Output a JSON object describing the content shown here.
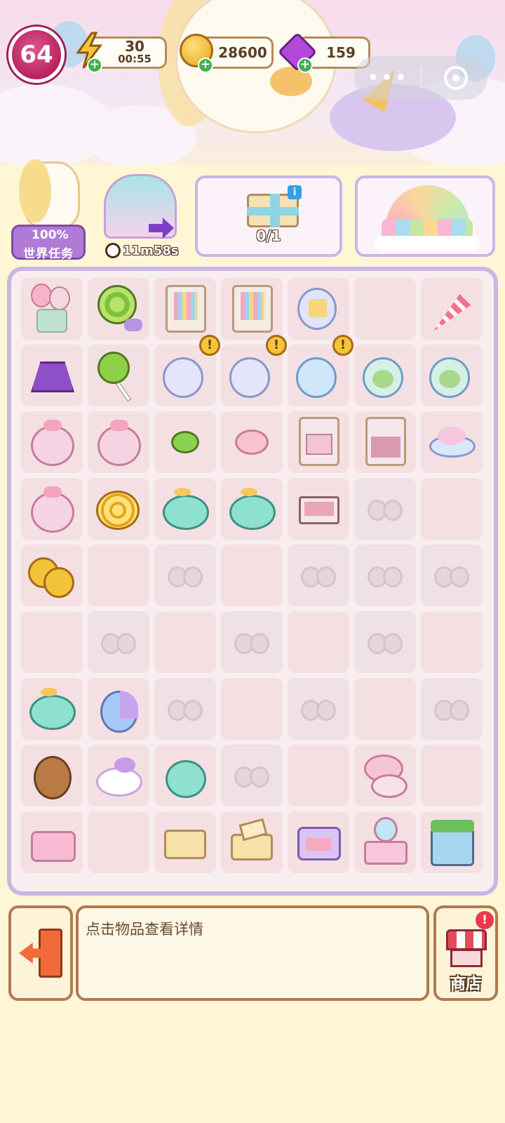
{
  "status": {
    "level": "64",
    "energy": "30",
    "energy_timer": "00:55",
    "coins": "28600",
    "gems": "159"
  },
  "features": {
    "world_task_percent": "100%",
    "world_task_label": "世界任务",
    "event_timer": "11m58s",
    "gift_progress": "0/1"
  },
  "board": {
    "cells": [
      "balloon-gift",
      "lollipop-swirl",
      "cabinet-open",
      "cabinet-open",
      "jar-candy",
      "empty",
      "party-popper",
      "skirt",
      "lollipop-green",
      "jar-empty",
      "jar-empty",
      "jar-blue",
      "jar-green-candy",
      "jar-green-candy",
      "candy-bag",
      "candy-bag",
      "wrapped-candy",
      "mochi",
      "dresser",
      "nightstand",
      "candy-plate",
      "candy-bag",
      "coin-pile",
      "dino-plush",
      "dino-plush",
      "drawer",
      "locked",
      "empty",
      "coins",
      "empty",
      "locked",
      "empty",
      "locked",
      "locked",
      "locked",
      "empty",
      "locked",
      "empty",
      "locked",
      "empty",
      "locked",
      "empty",
      "dino-plush",
      "cat-plush",
      "locked",
      "empty",
      "locked",
      "empty",
      "locked",
      "bear-plush",
      "unicorn-plush",
      "elephant-plush",
      "locked",
      "empty",
      "compact-open",
      "empty",
      "bed",
      "empty",
      "gift-box-closed",
      "gift-box-open",
      "compact-closed",
      "vanity",
      "shop-house"
    ],
    "alerts": [
      9,
      10,
      11
    ]
  },
  "detail_text": "点击物品查看详情",
  "shop_label": "商店",
  "colors": {
    "accent_pink": "#b7245f",
    "board_border": "#c9b6e3",
    "button_border": "#b27a4e",
    "energy_bolt": "#f6c33b",
    "gem": "#b14ad8"
  }
}
